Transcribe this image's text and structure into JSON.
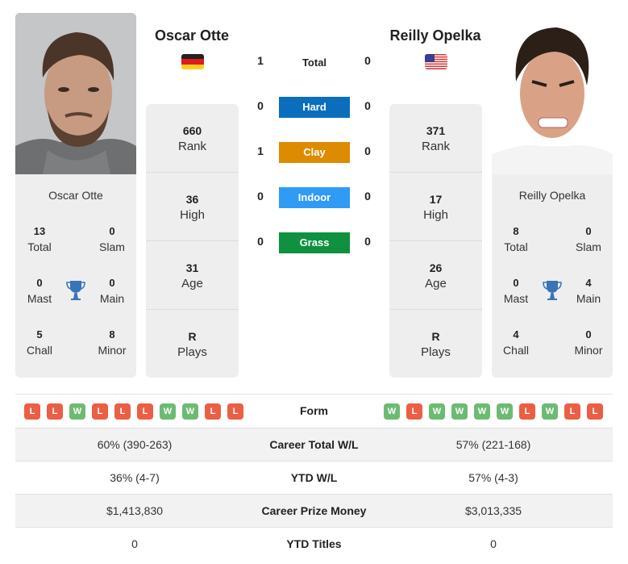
{
  "players": [
    {
      "name": "Oscar Otte",
      "country_flag": "germany-flag",
      "photo": "oscar-otte-photo",
      "rank": "660",
      "rank_label": "Rank",
      "high": "36",
      "high_label": "High",
      "age": "31",
      "age_label": "Age",
      "plays": "R",
      "plays_label": "Plays",
      "titles": {
        "total": "13",
        "total_label": "Total",
        "slam": "0",
        "slam_label": "Slam",
        "mast": "0",
        "mast_label": "Mast",
        "main": "0",
        "main_label": "Main",
        "chall": "5",
        "chall_label": "Chall",
        "minor": "8",
        "minor_label": "Minor"
      },
      "form": [
        "L",
        "L",
        "W",
        "L",
        "L",
        "L",
        "W",
        "W",
        "L",
        "L"
      ],
      "career_wl": "60% (390-263)",
      "ytd_wl": "36% (4-7)",
      "prize_money": "$1,413,830",
      "ytd_titles": "0"
    },
    {
      "name": "Reilly Opelka",
      "country_flag": "usa-flag",
      "photo": "reilly-opelka-photo",
      "rank": "371",
      "rank_label": "Rank",
      "high": "17",
      "high_label": "High",
      "age": "26",
      "age_label": "Age",
      "plays": "R",
      "plays_label": "Plays",
      "titles": {
        "total": "8",
        "total_label": "Total",
        "slam": "0",
        "slam_label": "Slam",
        "mast": "0",
        "mast_label": "Mast",
        "main": "4",
        "main_label": "Main",
        "chall": "4",
        "chall_label": "Chall",
        "minor": "0",
        "minor_label": "Minor"
      },
      "form": [
        "W",
        "L",
        "W",
        "W",
        "W",
        "W",
        "L",
        "W",
        "L",
        "L"
      ],
      "career_wl": "57% (221-168)",
      "ytd_wl": "57% (4-3)",
      "prize_money": "$3,013,335",
      "ytd_titles": "0"
    }
  ],
  "h2h": {
    "total_label": "Total",
    "total": [
      "1",
      "0"
    ],
    "surfaces": [
      {
        "label": "Hard",
        "left": "0",
        "right": "0",
        "color": "#0a6ebd"
      },
      {
        "label": "Clay",
        "left": "1",
        "right": "0",
        "color": "#dd8b00"
      },
      {
        "label": "Indoor",
        "left": "0",
        "right": "0",
        "color": "#2f9bf5"
      },
      {
        "label": "Grass",
        "left": "0",
        "right": "0",
        "color": "#0f9140"
      }
    ]
  },
  "comparison": {
    "form_label": "Form",
    "career_wl_label": "Career Total W/L",
    "ytd_wl_label": "YTD W/L",
    "prize_label": "Career Prize Money",
    "ytd_titles_label": "YTD Titles"
  },
  "colors": {
    "win": "#6dbb73",
    "loss": "#ea5f45",
    "trophy": "#3b73b9",
    "card_bg": "#eeeeee"
  }
}
